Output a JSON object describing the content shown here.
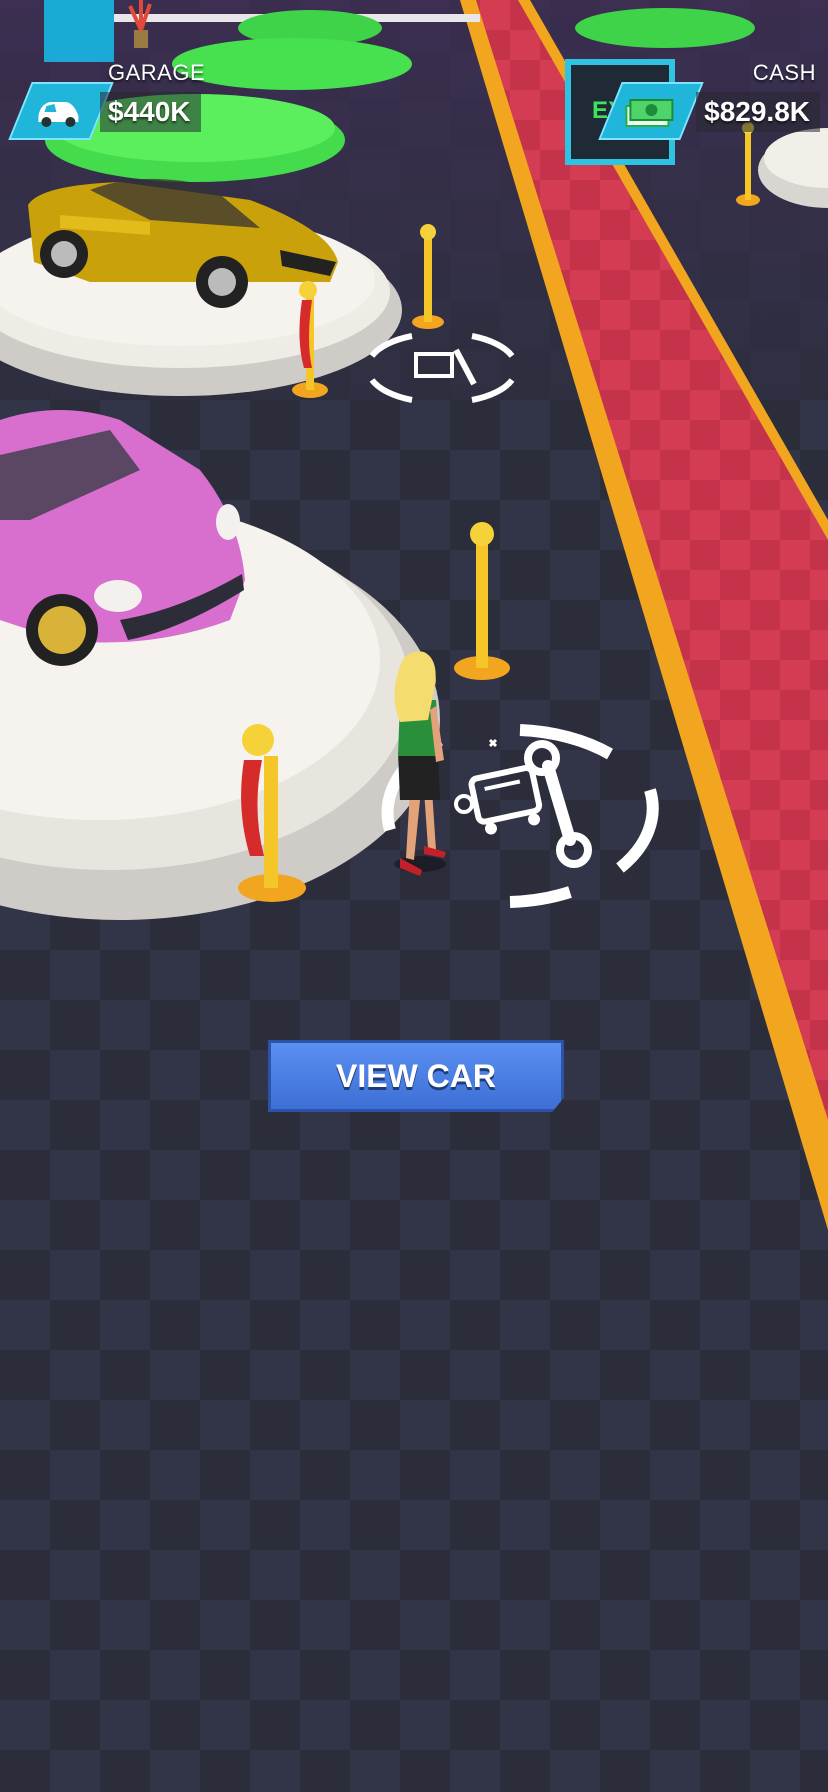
{
  "hud": {
    "garage_label": "GARAGE",
    "garage_value": "$440K",
    "cash_label": "CASH",
    "cash_value": "$829.8K"
  },
  "scene": {
    "exit_sign": "EXIT",
    "car_colors": [
      "yellow",
      "pink"
    ],
    "icons": [
      "car-icon",
      "cash-stack-icon",
      "repair-zone-icon",
      "stanchion-icon"
    ]
  },
  "actions": {
    "view_car_label": "VIEW CAR"
  },
  "colors": {
    "floor": "#2c2e3d",
    "carpet": "#c7344a",
    "carpet_border": "#f2a51f",
    "button": "#4a7ee3",
    "hud_badge": "#1fb6d9"
  }
}
